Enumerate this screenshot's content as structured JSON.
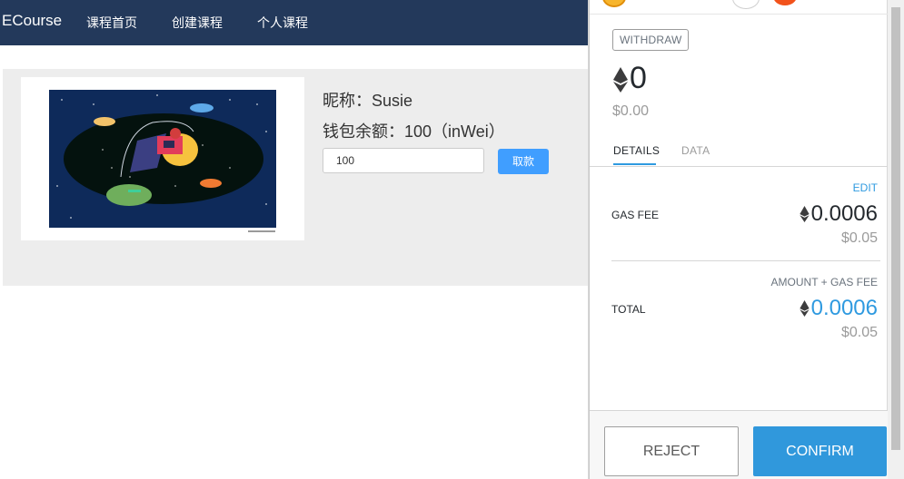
{
  "navbar": {
    "brand": "ECourse",
    "links": [
      "课程首页",
      "创建课程",
      "个人课程"
    ]
  },
  "profile": {
    "nickname_line": "昵称：Susie",
    "balance_line": "钱包余额：100（inWei）",
    "amount_value": "100",
    "withdraw_label": "取款"
  },
  "metamask": {
    "method_tag": "WITHDRAW",
    "eth_amount": "0",
    "usd_amount": "$0.00",
    "tabs": [
      "DETAILS",
      "DATA"
    ],
    "edit_label": "EDIT",
    "gas_fee_label": "GAS FEE",
    "gas_fee_eth": "0.0006",
    "gas_fee_usd": "$0.05",
    "amount_plus_gas_label": "AMOUNT + GAS FEE",
    "total_label": "TOTAL",
    "total_eth": "0.0006",
    "total_usd": "$0.05",
    "reject_label": "REJECT",
    "confirm_label": "CONFIRM"
  },
  "colors": {
    "navbar": "#23395b",
    "primary_button": "#409eff",
    "metamask_blue": "#3098dc"
  }
}
